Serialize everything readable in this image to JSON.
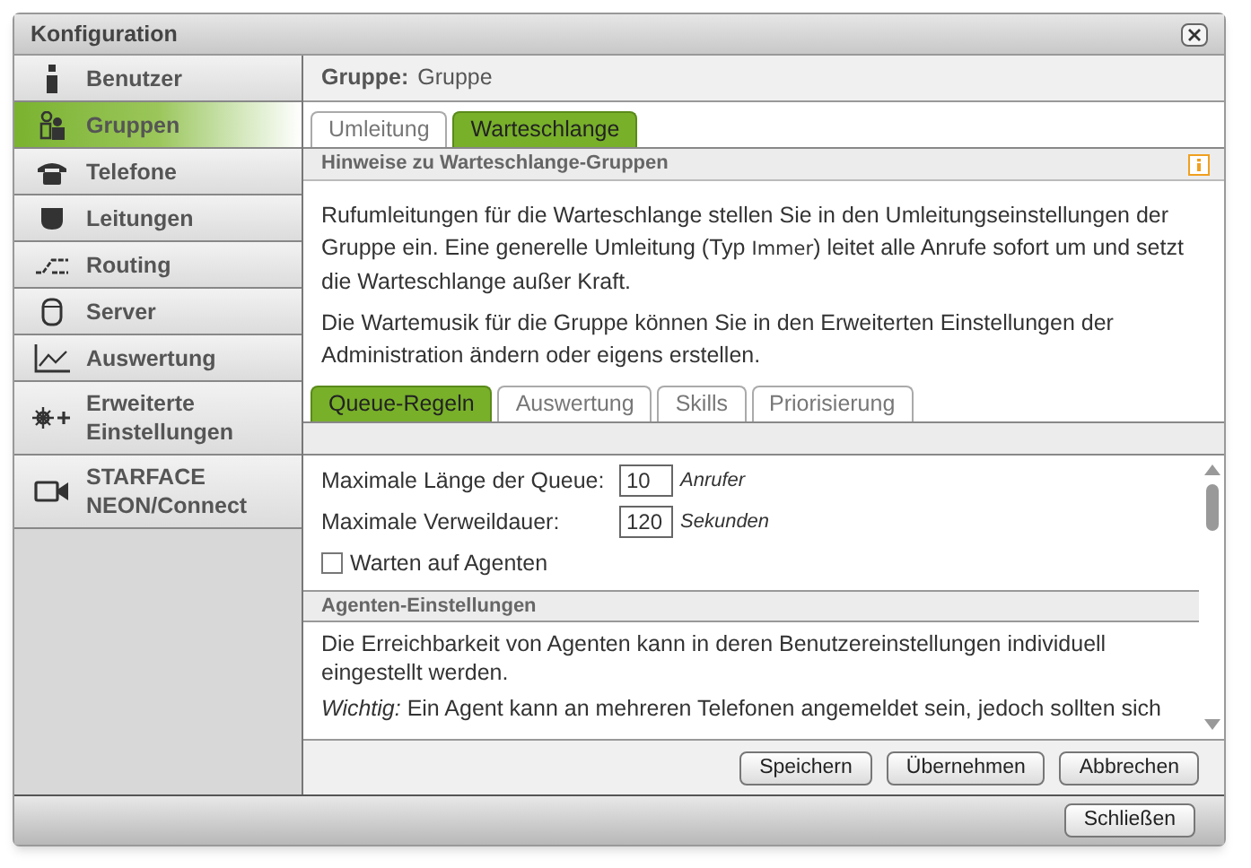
{
  "window": {
    "title": "Konfiguration"
  },
  "sidebar": {
    "items": [
      {
        "label": "Benutzer",
        "selected": false
      },
      {
        "label": "Gruppen",
        "selected": true
      },
      {
        "label": "Telefone",
        "selected": false
      },
      {
        "label": "Leitungen",
        "selected": false
      },
      {
        "label": "Routing",
        "selected": false
      },
      {
        "label": "Server",
        "selected": false
      },
      {
        "label": "Auswertung",
        "selected": false
      },
      {
        "label": "Erweiterte Einstellungen",
        "selected": false
      },
      {
        "label": "STARFACE NEON/Connect",
        "selected": false
      }
    ]
  },
  "header": {
    "label": "Gruppe:",
    "value": "Gruppe"
  },
  "tabs": [
    {
      "label": "Umleitung",
      "selected": false
    },
    {
      "label": "Warteschlange",
      "selected": true
    }
  ],
  "info_section": {
    "title": "Hinweise zu Warteschlange-Gruppen",
    "paragraph_1": {
      "before": "Rufumleitungen für die Warteschlange stellen Sie in den Umleitungseinstellungen der Gruppe ein. Eine generelle Umleitung (Typ ",
      "code": "Immer",
      "after": ") leitet alle Anrufe sofort um und setzt die Warteschlange außer Kraft."
    },
    "paragraph_2": "Die Wartemusik für die Gruppe können Sie in den Erweiterten Einstellungen der Administration ändern oder eigens erstellen."
  },
  "subtabs": [
    {
      "label": "Queue-Regeln",
      "selected": true
    },
    {
      "label": "Auswertung",
      "selected": false
    },
    {
      "label": "Skills",
      "selected": false
    },
    {
      "label": "Priorisierung",
      "selected": false
    }
  ],
  "form": {
    "fields": [
      {
        "label": "Maximale Länge der Queue:",
        "value": "10",
        "unit": "Anrufer"
      },
      {
        "label": "Maximale Verweildauer:",
        "value": "120",
        "unit": "Sekunden"
      }
    ],
    "checkbox": {
      "label": "Warten auf Agenten",
      "checked": false
    }
  },
  "agent_section": {
    "title": "Agenten-Einstellungen",
    "paragraph_1": "Die Erreichbarkeit von Agenten kann in deren Benutzereinstellungen individuell eingestellt werden.",
    "paragraph_2": "*Wichtig:* Ein Agent kann an mehreren Telefonen angemeldet sein, jedoch sollten sich"
  },
  "buttons": [
    "Speichern",
    "Übernehmen",
    "Abbrechen"
  ],
  "footer_buttons": [
    "Schließen"
  ]
}
